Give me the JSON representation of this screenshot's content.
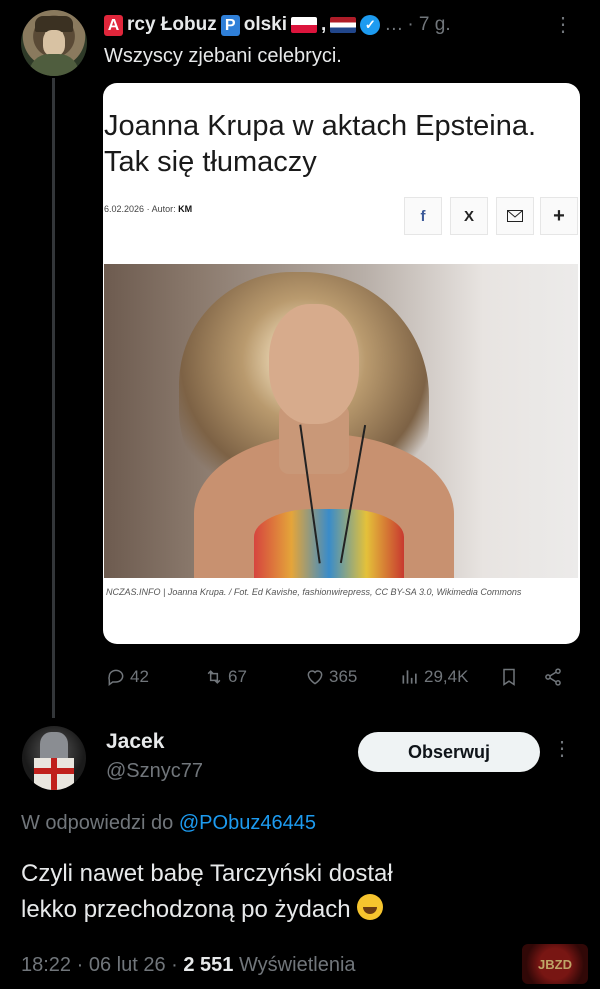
{
  "post": {
    "author_parts": [
      "A",
      "rcy Łobuz ",
      "P",
      "olski"
    ],
    "separator": ",",
    "ellipsis": "…",
    "time": "· 7 g.",
    "text": "Wszyscy zjebani celebryci.",
    "more_icon": "more-dots-icon",
    "card": {
      "title_line1": "Joanna Krupa w aktach Epsteina.",
      "title_line2": "Tak się tłumaczy",
      "date": "6.02.2026",
      "author_label": "Autor:",
      "author": "KM",
      "share_facebook": "f",
      "share_x": "X",
      "share_plus": "+",
      "caption": "NCZAS.INFO | Joanna Krupa. / Fot. Ed Kavishe, fashionwirepress, CC BY-SA 3.0, Wikimedia Commons"
    },
    "actions": {
      "replies": "42",
      "reposts": "67",
      "likes": "365",
      "views": "29,4K"
    }
  },
  "reply": {
    "name": "Jacek",
    "handle": "@Sznyc77",
    "follow_label": "Obserwuj",
    "replying_prefix": "W odpowiedzi do",
    "replying_to": "@PObuz46445",
    "text_line1": "Czyli nawet babę Tarczyński dostał",
    "text_line2": "lekko przechodzoną po żydach",
    "time": "18:22",
    "date": "06 lut 26",
    "views_count": "2 551",
    "views_label": "Wyświetlenia"
  },
  "watermark": "JBZD",
  "colors": {
    "background": "#000000",
    "text": "#e7e9ea",
    "muted": "#71767b",
    "link": "#1d9bf0"
  }
}
